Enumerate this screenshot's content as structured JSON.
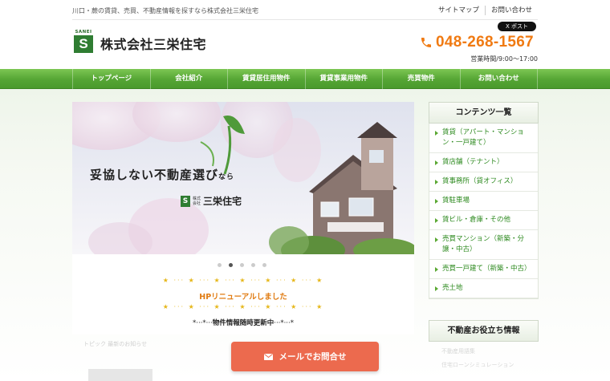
{
  "header": {
    "tagline": "川口・蕨の賃貸、売買、不動産情報を探すなら株式会社三栄住宅",
    "top_links": [
      "サイトマップ",
      "お問い合わせ"
    ],
    "logo_small": "SANEI",
    "logo_letter": "S",
    "company_name": "株式会社三栄住宅",
    "x_button": "X ポスト",
    "phone": "048-268-1567",
    "hours": "営業時間/9:00～17:00"
  },
  "nav": {
    "items": [
      "トップページ",
      "会社紹介",
      "賃貸居住用物件",
      "賃貸事業用物件",
      "売買物件",
      "お問い合わせ"
    ]
  },
  "hero": {
    "copy_main": "妥協しない不動産選び",
    "copy_suffix": "なら",
    "logo_small_1": "株式",
    "logo_small_2": "会社",
    "logo_name": "三栄住宅"
  },
  "main": {
    "sparkle_top": "★ ··· ★ ··· ★ ··· ★ ··· ★ ··· ★ ··· ★",
    "renewal": "HPリニューアルしました",
    "sparkle_bottom": "★ ··· ★ ··· ★ ··· ★ ··· ★ ··· ★ ··· ★",
    "update_prefix": "*···*···",
    "update_text": "物件情報随時更新中",
    "update_suffix": "···*···*",
    "faded_heading": "トピック 最新のお知らせ"
  },
  "sidebar": {
    "title": "コンテンツ一覧",
    "items": [
      "賃貸（アパート・マンション・一戸建て）",
      "賃店舗（テナント）",
      "賃事務所（貸オフィス）",
      "賃駐車場",
      "賃ビル・倉庫・その他",
      "売買マンション（新築・分譲・中古）",
      "売買一戸建て（新築・中古）",
      "売土地"
    ],
    "title2": "不動産お役立ち情報",
    "faded_items": [
      "不動産用語集",
      "住宅ローンシミュレーション"
    ]
  },
  "cta": {
    "label": "メールでお問合せ"
  },
  "colors": {
    "brand_green": "#2f7d32",
    "nav_green": "#55a534",
    "accent_orange": "#f07a12",
    "cta_red": "#ec6a4e"
  }
}
